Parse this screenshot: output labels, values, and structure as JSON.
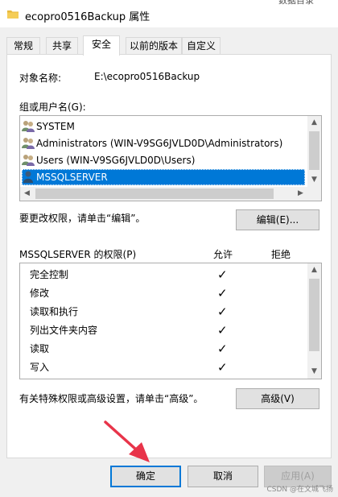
{
  "window": {
    "title": "ecopro0516Backup 属性",
    "top_cut_text": "数据目录"
  },
  "tabs": [
    {
      "label": "常规"
    },
    {
      "label": "共享"
    },
    {
      "label": "安全",
      "active": true
    },
    {
      "label": "以前的版本"
    },
    {
      "label": "自定义"
    }
  ],
  "security": {
    "object_name_label": "对象名称:",
    "object_name_value": "E:\\ecopro0516Backup",
    "group_label": "组或用户名(G):",
    "users": [
      {
        "name": "SYSTEM",
        "icon": "user-group-icon"
      },
      {
        "name": "Administrators (WIN-V9SG6JVLD0D\\Administrators)",
        "icon": "user-group-icon"
      },
      {
        "name": "Users (WIN-V9SG6JVLD0D\\Users)",
        "icon": "user-group-icon"
      },
      {
        "name": "MSSQLSERVER",
        "icon": "user-icon",
        "selected": true
      }
    ],
    "change_hint": "要更改权限，请单击“编辑”。",
    "edit_button": "编辑(E)...",
    "perm_header": "MSSQLSERVER 的权限(P)",
    "allow_header": "允许",
    "deny_header": "拒绝",
    "permissions": [
      {
        "name": "完全控制",
        "allow": "✓"
      },
      {
        "name": "修改",
        "allow": "✓"
      },
      {
        "name": "读取和执行",
        "allow": "✓"
      },
      {
        "name": "列出文件夹内容",
        "allow": "✓"
      },
      {
        "name": "读取",
        "allow": "✓"
      },
      {
        "name": "写入",
        "allow": "✓"
      }
    ],
    "advanced_hint": "有关特殊权限或高级设置，请单击“高级”。",
    "advanced_button": "高级(V)"
  },
  "footer": {
    "ok": "确定",
    "cancel": "取消",
    "apply": "应用(A)"
  },
  "watermark": "CSDN @在文城飞扬",
  "colors": {
    "selection": "#0078d7",
    "arrow": "#e8344a"
  }
}
